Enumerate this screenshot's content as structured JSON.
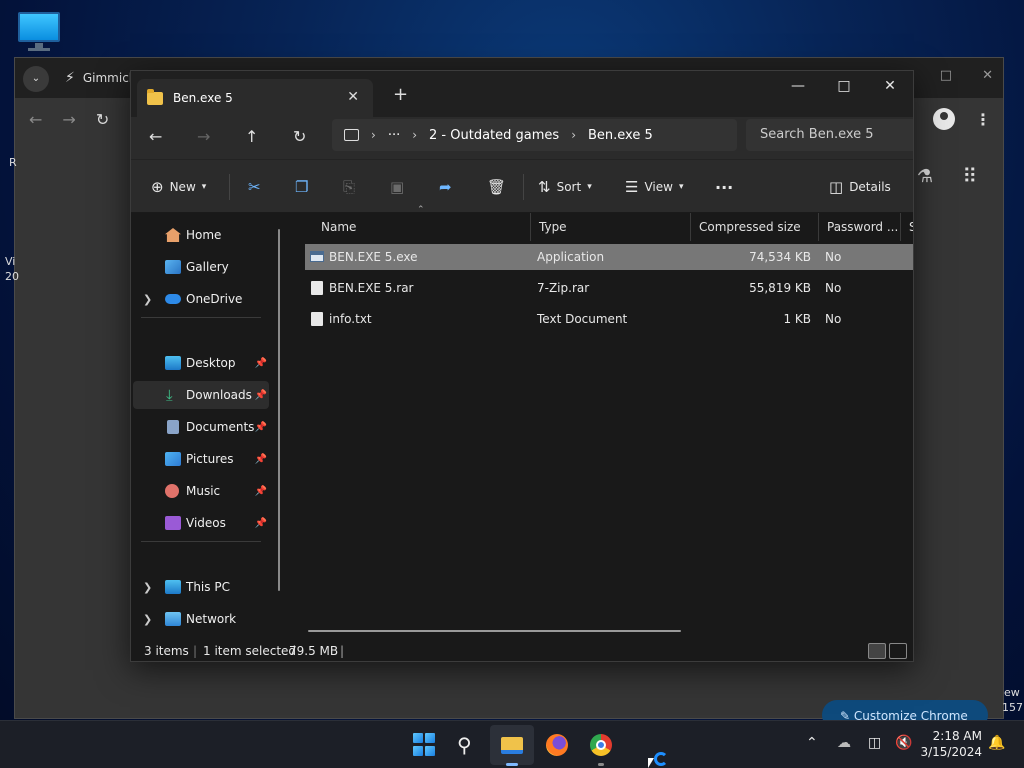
{
  "chrome": {
    "tab_title": "Gimmicl",
    "side_text_1": "R",
    "side_text_2a": "Vi",
    "side_text_2b": "20",
    "side_text_3a": "ew",
    "side_text_3b": "157",
    "customize_label": "Customize Chrome"
  },
  "explorer": {
    "tab_title": "Ben.exe 5",
    "breadcrumb": {
      "more": "···",
      "items": [
        "2 - Outdated games",
        "Ben.exe 5"
      ]
    },
    "search_placeholder": "Search Ben.exe 5",
    "command_bar": {
      "new_label": "New",
      "sort_label": "Sort",
      "view_label": "View",
      "more_label": "···",
      "details_label": "Details"
    },
    "nav_pane": {
      "items": [
        {
          "label": "Home"
        },
        {
          "label": "Gallery"
        },
        {
          "label": "OneDrive"
        },
        {
          "label": "Desktop"
        },
        {
          "label": "Downloads"
        },
        {
          "label": "Documents"
        },
        {
          "label": "Pictures"
        },
        {
          "label": "Music"
        },
        {
          "label": "Videos"
        },
        {
          "label": "This PC"
        },
        {
          "label": "Network"
        }
      ]
    },
    "columns": [
      "Name",
      "Type",
      "Compressed size",
      "Password ...",
      "Si"
    ],
    "rows": [
      {
        "name": "BEN.EXE 5.exe",
        "type": "Application",
        "size": "74,534 KB",
        "password": "No"
      },
      {
        "name": "BEN.EXE 5.rar",
        "type": "7-Zip.rar",
        "size": "55,819 KB",
        "password": "No"
      },
      {
        "name": "info.txt",
        "type": "Text Document",
        "size": "1 KB",
        "password": "No"
      }
    ],
    "status": {
      "items_count": "3 items",
      "selection": "1 item selected",
      "selection_size": "79.5 MB"
    }
  },
  "taskbar": {
    "time": "2:18 AM",
    "date": "3/15/2024"
  },
  "colors": {
    "accent": "#1e8fff",
    "selection": "#777777",
    "window_bg": "#191919"
  }
}
